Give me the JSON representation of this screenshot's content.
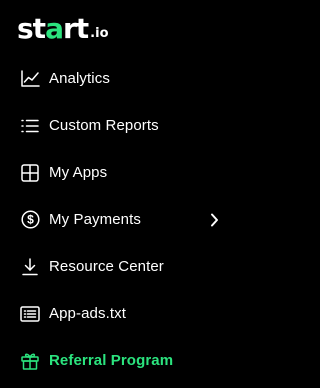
{
  "logo": {
    "part1": "st",
    "part2": "a",
    "part3": "rt",
    "suffix": ".io"
  },
  "colors": {
    "accent": "#2be37e",
    "background": "#000000",
    "text": "#ffffff"
  },
  "nav": {
    "items": [
      {
        "label": "Analytics",
        "icon": "chart-line-icon"
      },
      {
        "label": "Custom Reports",
        "icon": "list-icon"
      },
      {
        "label": "My Apps",
        "icon": "grid-icon"
      },
      {
        "label": "My Payments",
        "icon": "dollar-circle-icon",
        "has_chevron": true
      },
      {
        "label": "Resource Center",
        "icon": "download-icon"
      },
      {
        "label": "App-ads.txt",
        "icon": "document-list-icon"
      },
      {
        "label": "Referral Program",
        "icon": "gift-icon",
        "active": true
      }
    ]
  }
}
